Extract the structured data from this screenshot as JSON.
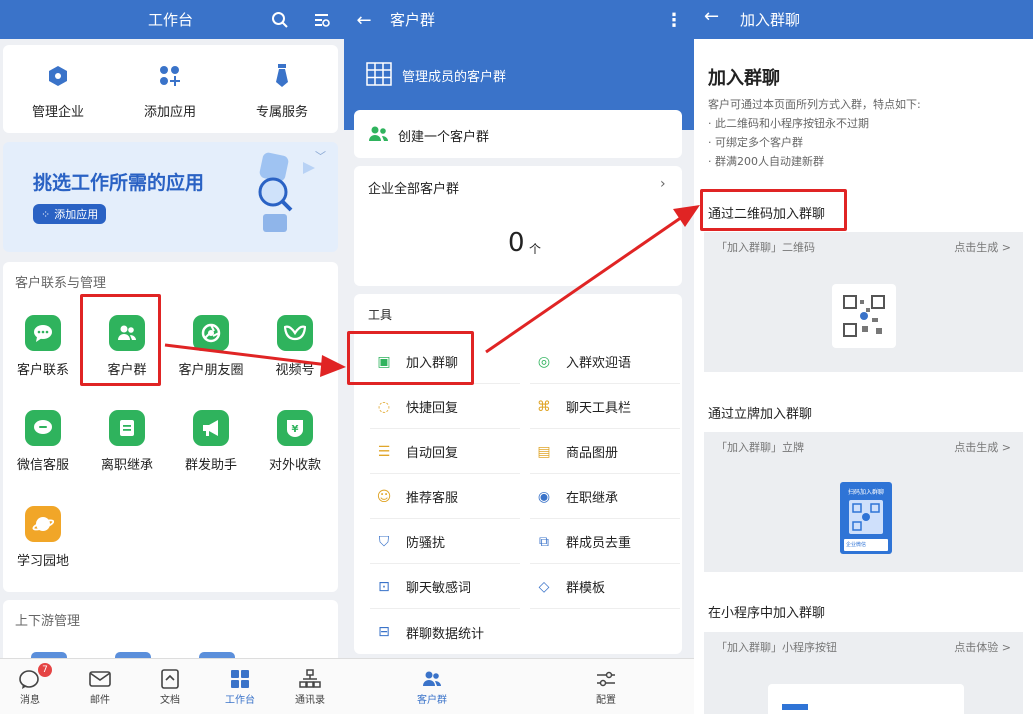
{
  "panel1": {
    "title": "工作台",
    "top_actions": [
      {
        "label": "管理企业",
        "icon": "hexagon-icon"
      },
      {
        "label": "添加应用",
        "icon": "grid-plus-icon"
      },
      {
        "label": "专属服务",
        "icon": "tie-icon"
      }
    ],
    "banner": {
      "title": "挑选工作所需的应用",
      "button": "添加应用"
    },
    "section1": {
      "title": "客户联系与管理",
      "apps": [
        {
          "label": "客户联系",
          "icon": "chat-bubble-icon",
          "color": "#2fb35d"
        },
        {
          "label": "客户群",
          "icon": "group-icon",
          "color": "#2fb35d"
        },
        {
          "label": "客户朋友圈",
          "icon": "aperture-icon",
          "color": "#2fb35d"
        },
        {
          "label": "视频号",
          "icon": "butterfly-icon",
          "color": "#2fb35d"
        },
        {
          "label": "微信客服",
          "icon": "chat-dots-icon",
          "color": "#2fb35d"
        },
        {
          "label": "离职继承",
          "icon": "document-icon",
          "color": "#2fb35d"
        },
        {
          "label": "群发助手",
          "icon": "megaphone-icon",
          "color": "#2fb35d"
        },
        {
          "label": "对外收款",
          "icon": "yuan-shield-icon",
          "color": "#2fb35d"
        },
        {
          "label": "学习园地",
          "icon": "planet-icon",
          "color": "#f1a628"
        }
      ]
    },
    "section2": {
      "title": "上下游管理"
    },
    "tabs": [
      {
        "label": "消息",
        "icon": "message-icon",
        "badge": "7"
      },
      {
        "label": "邮件",
        "icon": "mail-icon"
      },
      {
        "label": "文档",
        "icon": "doc-icon"
      },
      {
        "label": "工作台",
        "icon": "workbench-icon",
        "active": true
      },
      {
        "label": "通讯录",
        "icon": "contacts-icon"
      }
    ]
  },
  "panel2": {
    "title": "客户群",
    "header_label": "管理成员的客户群",
    "create_label": "创建一个客户群",
    "all_groups_label": "企业全部客户群",
    "count": "0",
    "count_unit": "个",
    "tools_title": "工具",
    "tools": [
      {
        "label": "加入群聊",
        "icon": "qr-icon"
      },
      {
        "label": "入群欢迎语",
        "icon": "welcome-icon"
      },
      {
        "label": "快捷回复",
        "icon": "quick-reply-icon"
      },
      {
        "label": "聊天工具栏",
        "icon": "toolbar-icon"
      },
      {
        "label": "自动回复",
        "icon": "auto-reply-icon"
      },
      {
        "label": "商品图册",
        "icon": "catalog-icon"
      },
      {
        "label": "推荐客服",
        "icon": "recommend-icon"
      },
      {
        "label": "在职继承",
        "icon": "inherit-icon"
      },
      {
        "label": "防骚扰",
        "icon": "shield-icon"
      },
      {
        "label": "群成员去重",
        "icon": "dedupe-icon"
      },
      {
        "label": "聊天敏感词",
        "icon": "sensitive-icon"
      },
      {
        "label": "群模板",
        "icon": "template-icon"
      },
      {
        "label": "群聊数据统计",
        "icon": "stats-icon"
      }
    ],
    "tabs": [
      {
        "label": "客户群",
        "icon": "group-icon",
        "active": true
      },
      {
        "label": "配置",
        "icon": "settings-sliders-icon"
      }
    ]
  },
  "panel3": {
    "title": "加入群聊",
    "heading": "加入群聊",
    "desc": "客户可通过本页面所列方式入群，特点如下:",
    "bullets": [
      "· 此二维码和小程序按钮永不过期",
      "· 可绑定多个客户群",
      "· 群满200人自动建新群"
    ],
    "sections": [
      {
        "title": "通过二维码加入群聊",
        "item": "「加入群聊」二维码",
        "action": "点击生成 >"
      },
      {
        "title": "通过立牌加入群聊",
        "item": "「加入群聊」立牌",
        "action": "点击生成 >",
        "card_title": "扫码加入群聊",
        "card_brand": "企业微信"
      },
      {
        "title": "在小程序中加入群聊",
        "item": "「加入群聊」小程序按钮",
        "action": "点击体验 >"
      }
    ]
  },
  "colors": {
    "brand": "#3a73c9",
    "green": "#2fb35d",
    "highlight": "#e02424"
  }
}
